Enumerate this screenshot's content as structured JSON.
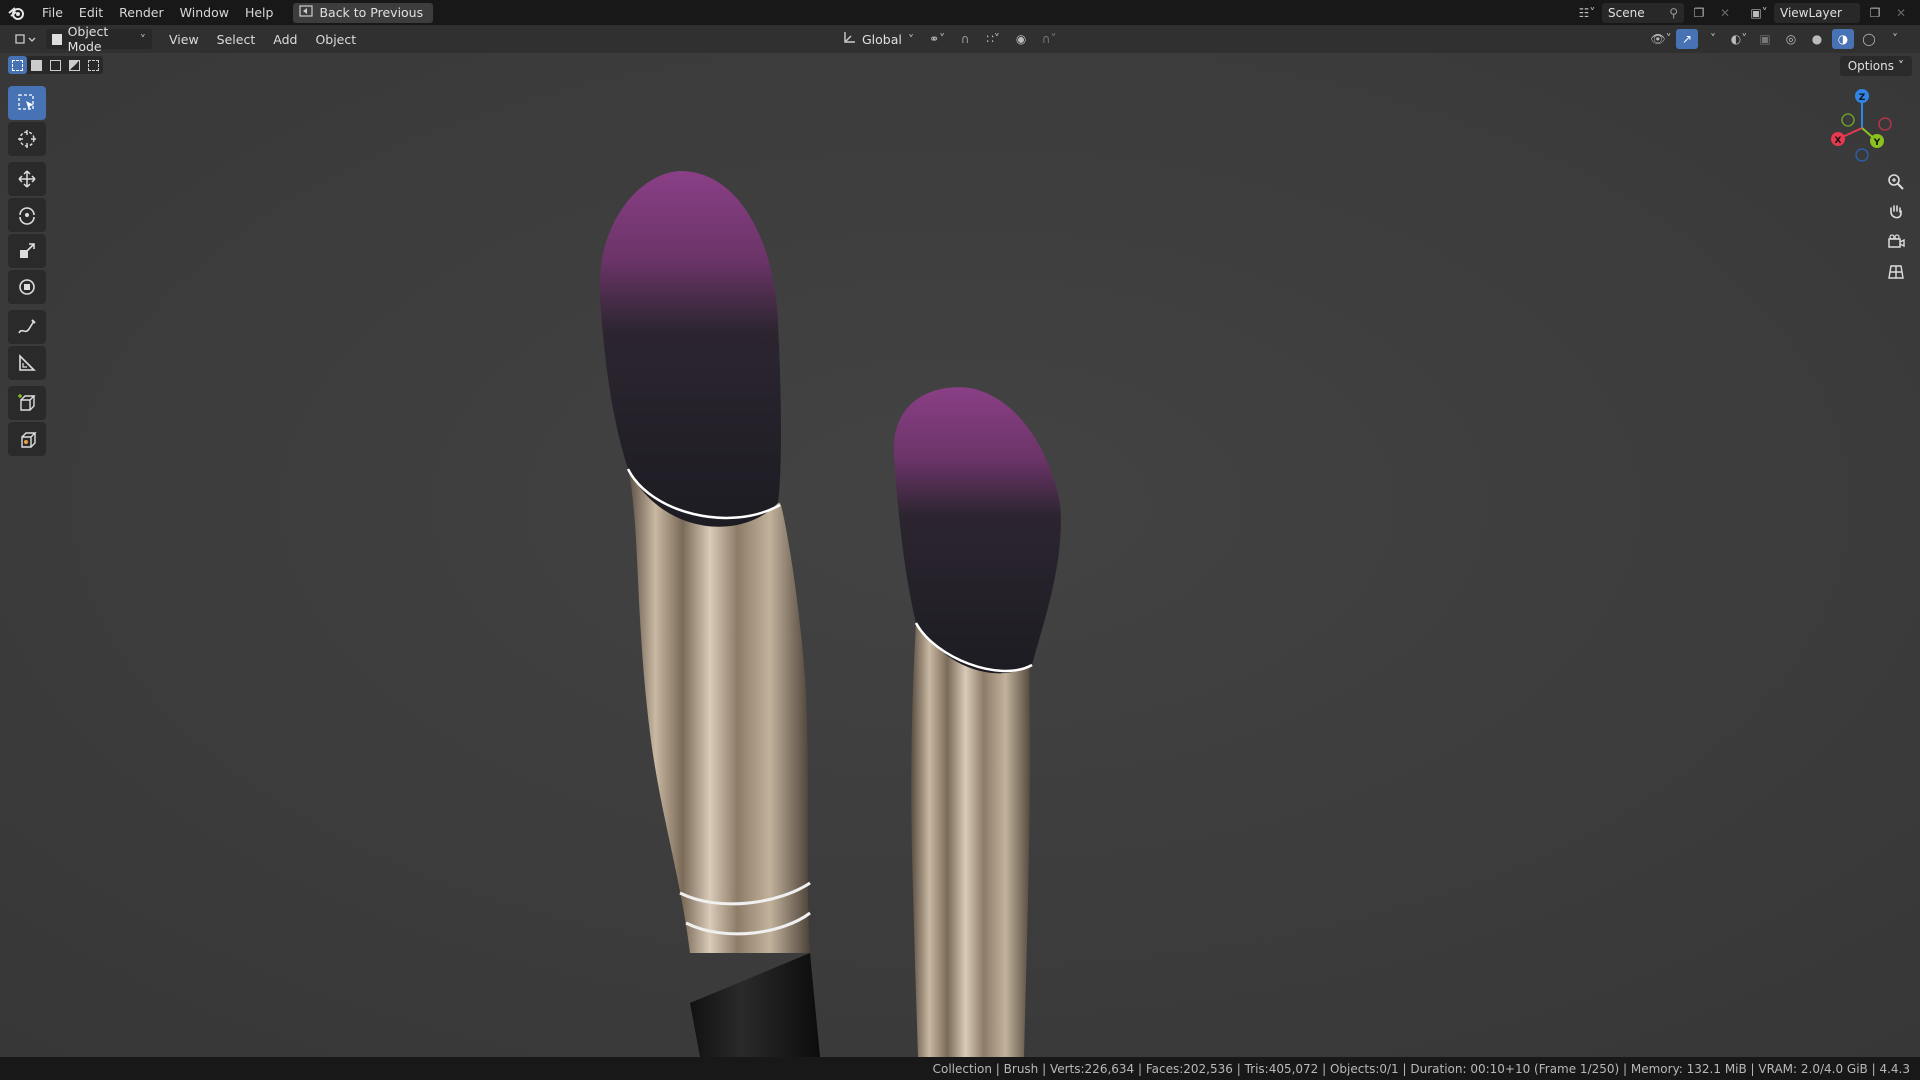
{
  "topbar": {
    "menus": [
      "File",
      "Edit",
      "Render",
      "Window",
      "Help"
    ],
    "back_label": "Back to Previous",
    "scene_label": "Scene",
    "viewlayer_label": "ViewLayer"
  },
  "header": {
    "mode_label": "Object Mode",
    "menus": [
      "View",
      "Select",
      "Add",
      "Object"
    ],
    "orientation_label": "Global",
    "options_label": "Options"
  },
  "toolbar": {
    "tools": [
      "select-box",
      "cursor",
      "move",
      "rotate",
      "scale",
      "transform",
      "annotate",
      "measure",
      "add-cube",
      "add-object"
    ]
  },
  "gizmo": {
    "x": "X",
    "y": "Y",
    "z": "Z"
  },
  "statusbar": {
    "text": "Collection | Brush | Verts:226,634 | Faces:202,536 | Tris:405,072 | Objects:0/1 | Duration: 00:10+10 (Frame 1/250) | Memory: 132.1 MiB | VRAM: 2.0/4.0 GiB | 4.4.3"
  },
  "colors": {
    "accent": "#4772b3",
    "bristle_tip": "#8a3f86",
    "bristle_base": "#1c1c22",
    "ferrule": "#a89580",
    "axis_x": "#e8384f",
    "axis_y": "#8bc220",
    "axis_z": "#2f86e8"
  }
}
